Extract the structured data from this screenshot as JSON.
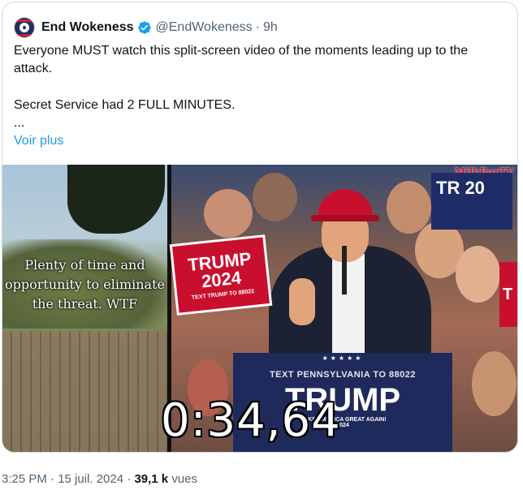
{
  "tweet": {
    "author_name": "End Wokeness",
    "handle": "@EndWokeness",
    "separator": "·",
    "time_ago": "9h",
    "text_line1": "Everyone MUST watch this split-screen video of the moments leading up to the attack.",
    "text_line2": "Secret Service had 2 FULL MINUTES.",
    "text_line3": "...",
    "show_more_label": "Voir plus"
  },
  "media": {
    "left_caption_line1": "Plenty of time and",
    "left_caption_line2": "opportunity to eliminate",
    "left_caption_line3": "the threat. WTF",
    "watermark": "MilkBarTV",
    "timer": "0:34,64",
    "sign_line1": "TRUMP",
    "sign_line2": "2024",
    "sign_small": "TEXT TRUMP TO 88022",
    "podium_line1": "TEXT PENNSYLVANIA TO 88022",
    "podium_line2": "TRUMP",
    "podium_line3": "MAKE AMERICA GREAT AGAIN!",
    "podium_line4": "2024",
    "right_sign_text": "TR 20",
    "right_edge_sign_text": "T"
  },
  "footer": {
    "timestamp": "3:25 PM · 15 juil. 2024",
    "dot": "·",
    "views_count": "39,1 k",
    "views_label": "vues"
  },
  "colors": {
    "link": "#1d9bf0",
    "verified": "#1d9bf0",
    "secondary_text": "#536471",
    "border": "#cfd9de"
  },
  "icons": {
    "verified": "verified-badge-icon",
    "avatar": "avatar-logo-icon"
  }
}
